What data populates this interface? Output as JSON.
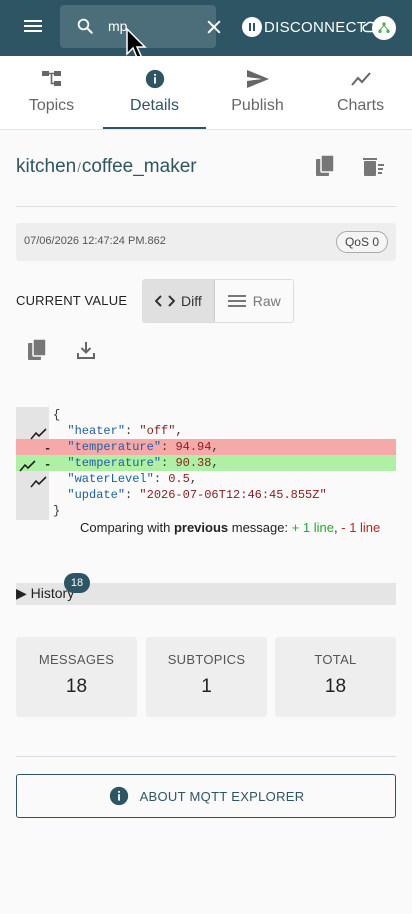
{
  "appbar": {
    "search_value": "mp",
    "disconnect_label": "DISCONNECT",
    "icons": [
      "menu-icon",
      "search-icon",
      "close-icon",
      "pause-icon",
      "cloud-off-icon"
    ]
  },
  "tabs": [
    {
      "label": "Topics",
      "icon": "topics-icon"
    },
    {
      "label": "Details",
      "icon": "info-icon"
    },
    {
      "label": "Publish",
      "icon": "send-icon"
    },
    {
      "label": "Charts",
      "icon": "chart-icon"
    }
  ],
  "active_tab": "Details",
  "topic": {
    "segments": [
      "kitchen",
      "coffee_maker"
    ],
    "separator": "/"
  },
  "message": {
    "timestamp": "07/06/2026 12:47:24 PM.862",
    "qos": "QoS 0"
  },
  "value": {
    "label": "CURRENT VALUE",
    "diff_label": "Diff",
    "raw_label": "Raw",
    "mode": "Diff"
  },
  "diff": {
    "lines": [
      {
        "type": "context",
        "text": "{"
      },
      {
        "type": "context",
        "text": "  \"heater\": \"off\","
      },
      {
        "type": "removed",
        "text": "  \"temperature\": 94.94,"
      },
      {
        "type": "added",
        "text": "  \"temperature\": 90.38,"
      },
      {
        "type": "context",
        "text": "  \"waterLevel\": 0.5,"
      },
      {
        "type": "context",
        "text": "  \"update\": \"2026-07-06T12:46:45.855Z\""
      },
      {
        "type": "context",
        "text": "}"
      }
    ],
    "compare_prefix": "Comparing with ",
    "compare_bold": "previous",
    "compare_mid": " message: ",
    "added_text": "+ 1 line",
    "sep_text": ", ",
    "removed_text": "- 1 line"
  },
  "history": {
    "label": "▶ History",
    "count": "18"
  },
  "stats": [
    {
      "label": "MESSAGES",
      "value": "18"
    },
    {
      "label": "SUBTOPICS",
      "value": "1"
    },
    {
      "label": "TOTAL",
      "value": "18"
    }
  ],
  "about": {
    "label": "ABOUT MQTT EXPLORER"
  },
  "colors": {
    "primary": "#2d5563",
    "removed_bg": "#f6a9a9",
    "added_bg": "#aef0a4"
  }
}
